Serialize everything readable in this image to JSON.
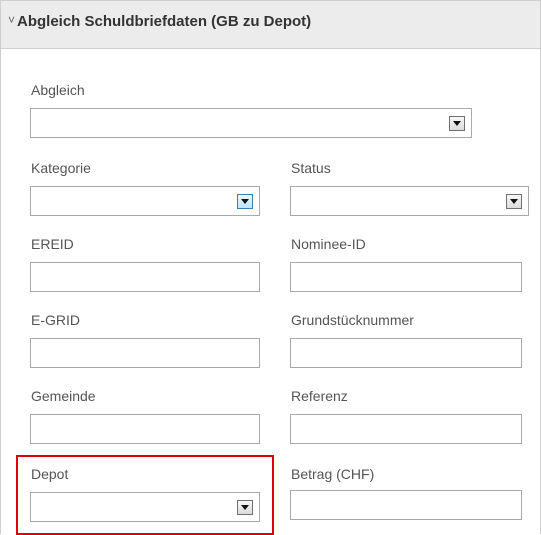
{
  "panel": {
    "title": "Abgleich Schuldbriefdaten (GB zu Depot)",
    "collapse_glyph": "˅",
    "collapse_icon": "chevron-down-icon"
  },
  "fields": {
    "abgleich": {
      "label": "Abgleich",
      "value": ""
    },
    "kategorie": {
      "label": "Kategorie",
      "value": ""
    },
    "status": {
      "label": "Status",
      "value": ""
    },
    "ereid": {
      "label": "EREID",
      "value": ""
    },
    "nominee_id": {
      "label": "Nominee-ID",
      "value": ""
    },
    "egrid": {
      "label": "E-GRID",
      "value": ""
    },
    "grundstuecknummer": {
      "label": "Grundstücknummer",
      "value": ""
    },
    "gemeinde": {
      "label": "Gemeinde",
      "value": ""
    },
    "referenz": {
      "label": "Referenz",
      "value": ""
    },
    "depot": {
      "label": "Depot",
      "value": ""
    },
    "betrag": {
      "label": "Betrag (CHF)",
      "value": ""
    }
  },
  "colors": {
    "highlight": "#e00000",
    "header_bg": "#ececec",
    "focused_dropdown": "#3c7fb1"
  }
}
